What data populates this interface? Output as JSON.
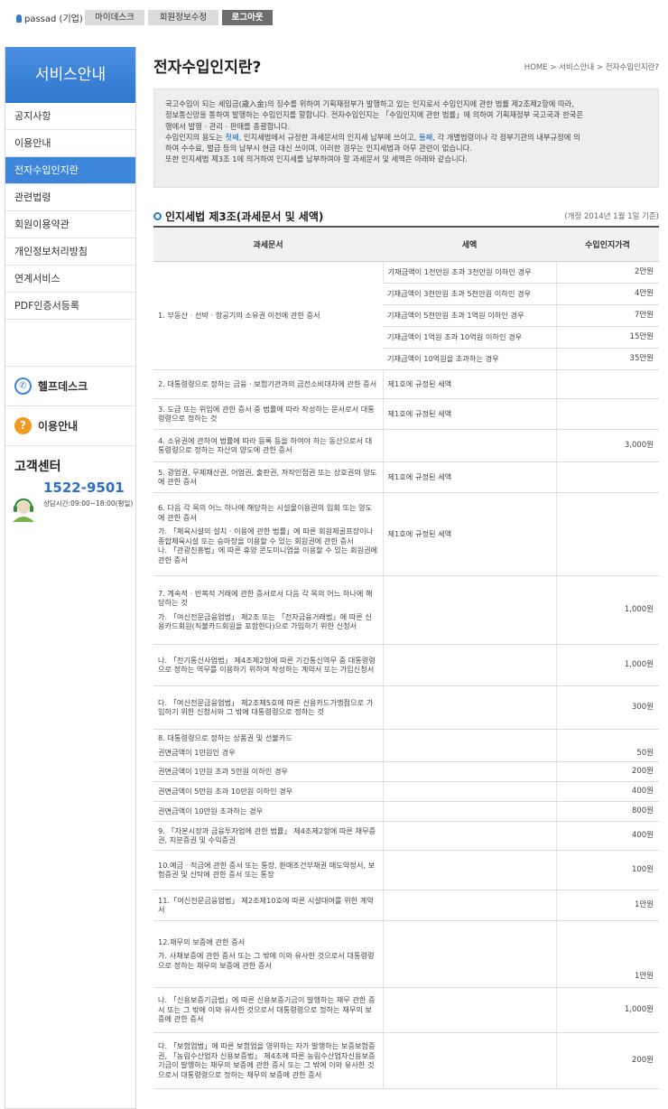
{
  "topbar": {
    "user": "passad (기업)",
    "btn_mydesk": "마이데스크",
    "btn_edit": "회원정보수정",
    "btn_logout": "로그아웃"
  },
  "sidebar": {
    "title": "서비스안내",
    "items": [
      {
        "label": "공지사항"
      },
      {
        "label": "이용안내"
      },
      {
        "label": "전자수입인지란"
      },
      {
        "label": "관련법령"
      },
      {
        "label": "회원이용약관"
      },
      {
        "label": "개인정보처리방침"
      },
      {
        "label": "연계서비스"
      },
      {
        "label": "PDF인증서등록"
      }
    ],
    "helpdesk": "헬프데스크",
    "guide": "이용안내",
    "cs_title": "고객센터",
    "cs_phone": "1522-9501",
    "cs_hours": "상담시간:09:00~18:00(평일)"
  },
  "main": {
    "title": "전자수입인지란?",
    "breadcrumb": "HOME > 서비스안내 > 전자수입인지란?",
    "info": {
      "p1": "국고수입이 되는 세입금(歲入金)의 징수를 위하여 기획재정부가 발행하고 있는 인지로서 수입인지에 관한 법률 제2조제2항에 따라,",
      "p2": "정보통신망을 통하여 발행하는 수입인지를 말합니다. 전자수입인지는 「수입인지에 관한 법률」에 의하여 기획재정부 국고국과 한국은",
      "p3": "행에서 발행 · 관리 · 판매를 총괄합니다.",
      "p4a": "수입인지의 용도는 ",
      "p4b": "첫째",
      "p4c": ", 인지세법에서 규정한 과세문서의 인지세 납부에 쓰이고, ",
      "p4d": "둘째",
      "p4e": ", 각 개별법령이나 각 정부기관의 내부규정에 의",
      "p5": "하여 수수료, 벌금 등의 납부시 현금 대신 쓰이며, 이러한 경우는 인지세법과 아무 관련이 없습니다.",
      "p6": "또한 인지세법 제3조 1에 의거하여 인지세를 납부하여야 할 과세문서 및 세액은 아래와 같습니다."
    },
    "section_title": "인지세법 제3조(과세문서 및 세액)",
    "section_note": "(개정 2014년 1월 1일 기준)",
    "table": {
      "headers": [
        "과세문서",
        "세액",
        "수입인지가격"
      ],
      "r1_doc": "1.  부동산 · 선박 · 항공기의 소유권 이전에 관한 증서",
      "r1": [
        {
          "tax": "기재금액이 1천만원 초과 3천만원 이하인 경우",
          "price": "2만원"
        },
        {
          "tax": "기재금액이 3천만원 초과 5천만원 이하인 경우",
          "price": "4만원"
        },
        {
          "tax": "기재금액이 5천만원 초과 1억원 이하인 경우",
          "price": "7만원"
        },
        {
          "tax": "기재금액이 1억원 초과 10억원 이하인 경우",
          "price": "15만원"
        },
        {
          "tax": "기재금액이 10억원을 초과하는 경우",
          "price": "35만원"
        }
      ],
      "r2_doc": "2.  대통령령으로 정하는 금융 · 보험기관과의 금전소비대차에 관한 증서",
      "r2_tax": "제1호에 규정된 세액",
      "r3_doc": "3.  도급 또는 위임에 관한 증서 중 법률에 따라 작성하는 문서로서 대통령령으로 정하는 것",
      "r3_tax": "제1호에 규정된 세액",
      "r4_doc": "4.  소유권에 관하여 법률에 따라 등록 등을 하여야 하는 동산으로서 대통령령으로 정하는 자산의 양도에 관한 증서",
      "r4_price": "3,000원",
      "r5_doc": "5.  광업권, 무체재산권, 어업권, 출판권, 저작인접권 또는 상호권의 양도에 관한 증서",
      "r5_tax": "제1호에 규정된 세액",
      "r6_doc": "6.  다음 각 목의 어느 하나에 해당하는 시설물이용권의 입회 또는 양도에 관한 증서",
      "r6_a": "가. 「체육시설의 설치 · 이용에 관한 법률」에 따른 회원제골프장이나 종합체육시설 또는 승마장을 이용할 수 있는 회원권에 관한 증서",
      "r6_b": "나. 「관광진흥법」에 따른 휴양 콘도미니엄을 이용할 수 있는 회원권에 관한 증서",
      "r6_tax": "제1호에 규정된 세액",
      "r7_doc": "7.  계속적 · 반복적 거래에 관한 증서로서 다음 각 목의 어느 하나에 해당하는 것",
      "r7_a": "가. 「여신전문금융업법」 제2조 또는 「전자금융거래법」에 따른 신용카드회원(직불카드회원을 포함한다)으로 가입하기 위한 신청서",
      "r7_a_price": "1,000원",
      "r7_b": "나. 「전기통신사업법」 제4조제2항에 따른 기간통신역무 중 대통령령으로 정하는 역무를 이용하기 위하여 작성하는 계약서 또는 가입신청서",
      "r7_b_price": "1,000원",
      "r7_c": "다. 「여신전문금융업법」 제2조제5호에 따른 신용카드가맹점으로 가입하기 위한 신청서와 그 밖에 대통령령으로 정하는 것",
      "r7_c_price": "300원",
      "r8_doc": "8.  대통령령으로 정하는 상품권 및 선불카드",
      "r8": [
        {
          "label": "권면금액이 1만원인 경우",
          "price": "50원"
        },
        {
          "label": "권면금액이 1만원 초과 5만원 이하인 경우",
          "price": "200원"
        },
        {
          "label": "권면금액이 5만원 초과 10만원 이하인 경우",
          "price": "400원"
        },
        {
          "label": "권면금액이 10만원 초과하는 경우",
          "price": "800원"
        }
      ],
      "r9_doc": "9. 「자본시장과 금융투자업에 관한 법률」 제4조제2항에 따른 채무증권, 지분증권 및 수익증권",
      "r9_price": "400원",
      "r10_doc": "10.예금 · 적금에 관한 증서 또는 통장, 환매조건부채권 매도약정서, 보험증권 및 신탁에 관한 증서 또는 통장",
      "r10_price": "100원",
      "r11_doc": "11.「여신전문금융업법」 제2조제10호에 따른 시설대여를 위한 계약서",
      "r11_price": "1만원",
      "r12_doc": "12.채무의 보증에 관한 증서",
      "r12_a": "가. 사채보증에 관한 증서 또는 그 밖에 이와 유사한 것으로서 대통령령으로 정하는 채무의 보증에 관한 증서",
      "r12_a_price": "1만원",
      "r12_b": "나. 「신용보증기금법」에 따른 신용보증기금이 발행하는 채무 관한 증서 또는 그 밖에 이와 유사한 것으로서 대통령령으로 정하는 채무의 보증에 관한 증서",
      "r12_b_price": "1,000원",
      "r12_c": "다. 「보험업법」에 따른 보험업을 영위하는 자가 발행하는 보증보험증권, 「농림수산업자 신용보증법」 제4조에 따른 농림수산업자신용보증기금이 발행하는 채무의 보증에 관한 증서 또는 그 밖에 이와 유사한 것으로서 대통령령으로 정하는 채무의 보증에 관한 증서",
      "r12_c_price": "200원"
    }
  },
  "colors": {
    "accent": "#2f78cf",
    "active_menu": "#3d86dc",
    "highlight": "#1a66c9"
  },
  "icons": [
    "user-icon",
    "phone-icon",
    "question-icon",
    "headset-avatar-icon",
    "circle-bullet-icon"
  ]
}
